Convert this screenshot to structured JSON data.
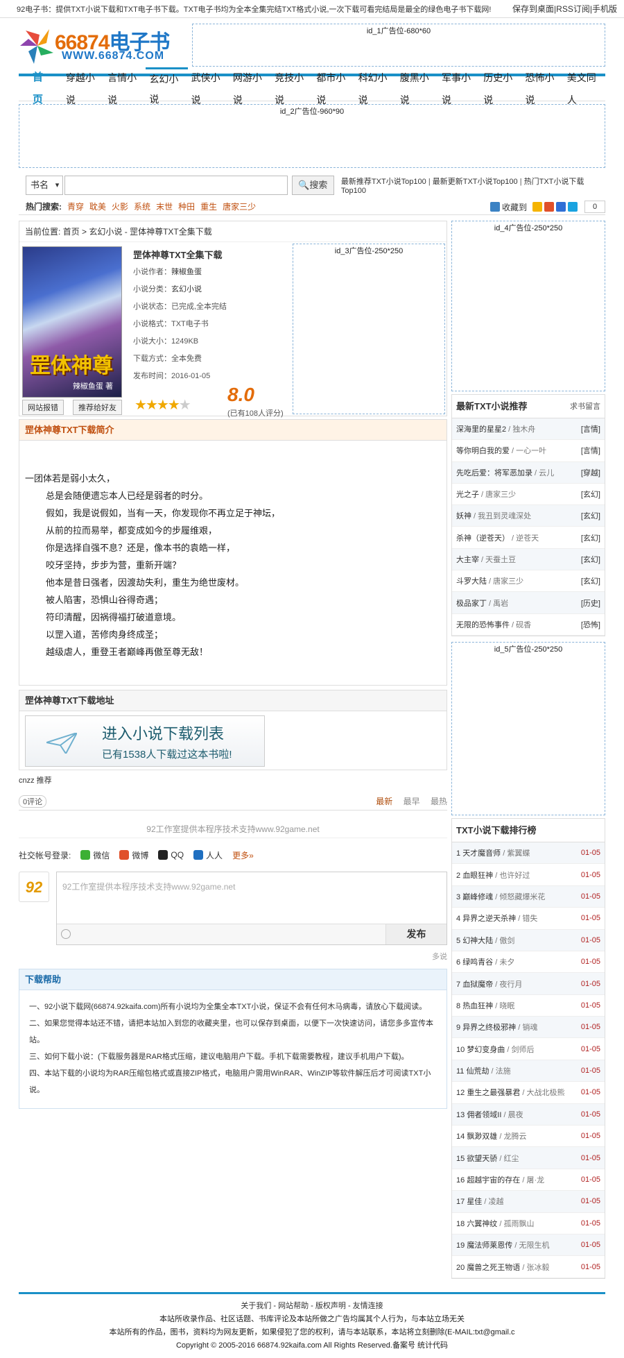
{
  "topbar": {
    "left": "92电子书：提供TXT小说下载和TXT电子书下载。TXT电子书均为全本全集完结TXT格式小说,一次下载可看完结局是最全的绿色电子书下载网!",
    "links": [
      "保存到桌面",
      "RSS订阅",
      "手机版"
    ]
  },
  "logo": {
    "brand": "66874",
    "brand_suffix": "电子书",
    "site": "WWW.66874.COM"
  },
  "ads": {
    "ad1": "id_1广告位-680*60",
    "ad2": "id_2广告位-960*90",
    "ad3": "id_3广告位-250*250",
    "ad4": "id_4广告位-250*250",
    "ad5": "id_5广告位-250*250"
  },
  "nav": {
    "home": "首页",
    "items": [
      "穿越小说",
      "言情小说",
      "玄幻小说",
      "武侠小说",
      "网游小说",
      "竞技小说",
      "都市小说",
      "科幻小说",
      "腹黑小说",
      "军事小说",
      "历史小说",
      "恐怖小说",
      "美文同人"
    ]
  },
  "search": {
    "select": "书名",
    "button": "搜索",
    "links": [
      "最新推荐TXT小说Top100",
      "最新更新TXT小说Top100",
      "热门TXT小说下载Top100"
    ]
  },
  "hot": {
    "label": "热门搜索:",
    "keywords": [
      "青穿",
      "耽美",
      "火影",
      "系统",
      "末世",
      "种田",
      "重生",
      "唐家三少"
    ]
  },
  "share": {
    "label": "收藏到",
    "count": "0"
  },
  "breadcrumb": {
    "label": "当前位置:",
    "home": "首页",
    "cat": "玄幻小说",
    "page": "罡体神尊TXT全集下载"
  },
  "book": {
    "title": "罡体神尊TXT全集下载",
    "cover_title": "罡体神尊",
    "cover_author": "辣椒鱼蛋 著",
    "author_label": "小说作者：",
    "author": "辣椒鱼蛋",
    "category_label": "小说分类：",
    "category": "玄幻小说",
    "status_label": "小说状态：",
    "status": "已完成,全本完结",
    "format_label": "小说格式：",
    "format": "TXT电子书",
    "size_label": "小说大小：",
    "size": "1249KB",
    "download_label": "下载方式：",
    "download": "全本免费",
    "date_label": "发布时间：",
    "date": "2016-01-05",
    "score": "8.0",
    "votes": "(已有108人评分)",
    "rating": 4,
    "btn_report": "网站报错",
    "btn_recommend": "推荐给好友"
  },
  "intro": {
    "title": "罡体神尊TXT下载简介",
    "first": "一团体若是弱小太久，",
    "lines": [
      "总是会随便遗忘本人已经是弱者的时分。",
      "假如，我是说假如，当有一天，你发现你不再立足于神坛，",
      "从前的拉而易举，都变成如今的步履维艰，",
      "你是选择自强不息？还是，像本书的袁皓一样，",
      "咬牙坚持，步步为营，重新开端？",
      "他本是昔日强者，因渡劫失利，重生为绝世废材。",
      "被人陷害，恐惧山谷得奇遇；",
      "符印清醒，因祸得福打破道意境。",
      "以罡入道，苦修肉身终成圣；",
      "越级虐人，重登王者巅峰再傲至尊无敌！"
    ]
  },
  "download": {
    "title": "罡体神尊TXT下载地址",
    "big": "进入小说下载列表",
    "small": "已有1538人下载过这本书啦!"
  },
  "comments": {
    "cnzz": "cnzz 推荐",
    "count": "0评论",
    "sorts": [
      "最新",
      "最早",
      "最热"
    ],
    "support": "92工作室提供本程序技术支持www.92game.net",
    "login_label": "社交帐号登录:",
    "providers": [
      "微信",
      "微博",
      "QQ",
      "人人"
    ],
    "more": "更多»",
    "avatar": "92",
    "placeholder": "92工作室提供本程序技术支持www.92game.net",
    "publish": "发布",
    "powered": "多说"
  },
  "help": {
    "title": "下载帮助",
    "items": [
      "一、92小说下载网(66874.92kaifa.com)所有小说均为全集全本TXT小说，保证不会有任何木马病毒，请放心下载阅读。",
      "二、如果您觉得本站还不错，请把本站加入到您的收藏夹里，也可以保存到桌面，以便下一次快速访问，请您多多宣传本站。",
      "三、如何下载小说：(下载服务器是RAR格式压缩，建议电脑用户下载。手机下载需要教程，建议手机用户下载)。",
      "四、本站下载的小说均为RAR压缩包格式或直接ZIP格式，电脑用户需用WinRAR、WinZIP等软件解压后才可阅读TXT小说。"
    ]
  },
  "recommend": {
    "title": "最新TXT小说推荐",
    "extra": "求书留言",
    "items": [
      {
        "name": "深海里的星星2",
        "author": "独木舟",
        "tag": "[言情]"
      },
      {
        "name": "等你明白我的爱",
        "author": "一心一叶",
        "tag": "[言情]"
      },
      {
        "name": "先吃后爱：将军恶加录",
        "author": "云儿",
        "tag": "[穿越]"
      },
      {
        "name": "光之子",
        "author": "唐家三少",
        "tag": "[玄幻]"
      },
      {
        "name": "妖神",
        "author": "我丑到灵魂深处",
        "tag": "[玄幻]"
      },
      {
        "name": "杀神（逆苍天）",
        "author": "逆苍天",
        "tag": "[玄幻]"
      },
      {
        "name": "大主宰",
        "author": "天蚕土豆",
        "tag": "[玄幻]"
      },
      {
        "name": "斗罗大陆",
        "author": "唐家三少",
        "tag": "[玄幻]"
      },
      {
        "name": "极品家丁",
        "author": "禹岩",
        "tag": "[历史]"
      },
      {
        "name": "无限的恐怖事件",
        "author": "砚香",
        "tag": "[恐怖]"
      }
    ]
  },
  "ranking": {
    "title": "TXT小说下载排行榜",
    "items": [
      {
        "no": "1",
        "name": "天才魔音师",
        "author": "紫翼蝶",
        "date": "01-05"
      },
      {
        "no": "2",
        "name": "血眼狂神",
        "author": "也许好过",
        "date": "01-05"
      },
      {
        "no": "3",
        "name": "巅峰修魂",
        "author": "倾怒藏爆米花",
        "date": "01-05"
      },
      {
        "no": "4",
        "name": "异界之逆天杀神",
        "author": "错失",
        "date": "01-05"
      },
      {
        "no": "5",
        "name": "幻神大陆",
        "author": "傲剑",
        "date": "01-05"
      },
      {
        "no": "6",
        "name": "绿鸣青谷",
        "author": "未夕",
        "date": "01-05"
      },
      {
        "no": "7",
        "name": "血狱魔帝",
        "author": "夜行月",
        "date": "01-05"
      },
      {
        "no": "8",
        "name": "热血狂神",
        "author": "晓眠",
        "date": "01-05"
      },
      {
        "no": "9",
        "name": "异界之终极邪神",
        "author": "销魂",
        "date": "01-05"
      },
      {
        "no": "10",
        "name": "梦幻变身曲",
        "author": "剑师后",
        "date": "01-05"
      },
      {
        "no": "11",
        "name": "仙荒劫",
        "author": "法施",
        "date": "01-05"
      },
      {
        "no": "12",
        "name": "重生之最强暴君",
        "author": "大战北极熊",
        "date": "01-05"
      },
      {
        "no": "13",
        "name": "佣者领域II",
        "author": "晨夜",
        "date": "01-05"
      },
      {
        "no": "14",
        "name": "飘渺双雄",
        "author": "龙腾云",
        "date": "01-05"
      },
      {
        "no": "15",
        "name": "欲望天骄",
        "author": "红尘",
        "date": "01-05"
      },
      {
        "no": "16",
        "name": "超越宇宙的存在",
        "author": "屠·龙",
        "date": "01-05"
      },
      {
        "no": "17",
        "name": "星佳",
        "author": "凌越",
        "date": "01-05"
      },
      {
        "no": "18",
        "name": "六翼神纹",
        "author": "孤雨飘山",
        "date": "01-05"
      },
      {
        "no": "19",
        "name": "魔法师莱恩传",
        "author": "无限生机",
        "date": "01-05"
      },
      {
        "no": "20",
        "name": "魔兽之死王物语",
        "author": "张冰毅",
        "date": "01-05"
      }
    ]
  },
  "footer": {
    "links": [
      "关于我们",
      "网站帮助",
      "版权声明",
      "友情连接"
    ],
    "line1": "本站所收录作品、社区话题、书库评论及本站所做之广告均属其个人行为，与本站立场无关",
    "line2": "本站所有的作品，图书，资料均为网友更新，如果侵犯了您的权利，请与本站联系，本站将立刻删除(E-MAIL:txt@gmail.c",
    "line3": "Copyright © 2005-2016 66874.92kaifa.com All Rights Reserved.备案号 统计代码"
  },
  "colors": {
    "accent": "#1a90c7",
    "orange": "#e36c0a",
    "tag": "#c05010"
  }
}
